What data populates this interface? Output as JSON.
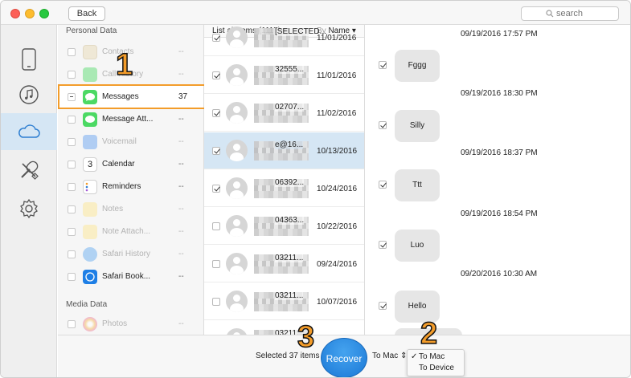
{
  "toolbar": {
    "back_label": "Back",
    "search_placeholder": "search"
  },
  "sidebar_rail": [
    {
      "name": "device-icon"
    },
    {
      "name": "itunes-icon"
    },
    {
      "name": "icloud-icon",
      "active": true
    },
    {
      "name": "tools-icon"
    },
    {
      "name": "settings-icon"
    }
  ],
  "categories": {
    "personal_title": "Personal Data",
    "items": [
      {
        "label": "Contacts",
        "count": "--",
        "dim": true,
        "icon": "contacts-icon",
        "color": "#e8d8b0"
      },
      {
        "label": "Call History",
        "count": "--",
        "dim": true,
        "icon": "phone-icon",
        "color": "#4cd964"
      },
      {
        "label": "Messages",
        "count": "37",
        "dim": false,
        "icon": "messages-icon",
        "color": "#4cd964"
      },
      {
        "label": "Message Att...",
        "count": "--",
        "dim": false,
        "icon": "message-attachments-icon",
        "color": "#4cd964"
      },
      {
        "label": "Voicemail",
        "count": "--",
        "dim": true,
        "icon": "voicemail-icon",
        "color": "#5b9bf0"
      },
      {
        "label": "Calendar",
        "count": "--",
        "dim": false,
        "icon": "calendar-icon",
        "color": "#ffffff",
        "text": "3"
      },
      {
        "label": "Reminders",
        "count": "--",
        "dim": false,
        "icon": "reminders-icon",
        "color": "#ffffff"
      },
      {
        "label": "Notes",
        "count": "--",
        "dim": true,
        "icon": "notes-icon",
        "color": "#fce48a"
      },
      {
        "label": "Note Attach...",
        "count": "--",
        "dim": true,
        "icon": "note-attachments-icon",
        "color": "#fce48a"
      },
      {
        "label": "Safari History",
        "count": "--",
        "dim": true,
        "icon": "safari-icon",
        "color": "#5aa7f0"
      },
      {
        "label": "Safari Book...",
        "count": "--",
        "dim": false,
        "icon": "safari-bookmarks-icon",
        "color": "#1e7fe6"
      }
    ],
    "media_title": "Media Data",
    "media_items": [
      {
        "label": "Photos",
        "count": "--",
        "dim": true,
        "icon": "photos-icon",
        "color": "#f7b84a"
      }
    ]
  },
  "list": {
    "header_left": "List all items (1117)",
    "header_right": "By Name",
    "rows": [
      {
        "contact": "[SELECTED...",
        "date": "11/01/2016",
        "checked": true,
        "selected": false
      },
      {
        "contact": "32555...",
        "date": "11/01/2016",
        "checked": true,
        "selected": false
      },
      {
        "contact": "02707...",
        "date": "11/02/2016",
        "checked": true,
        "selected": false
      },
      {
        "contact": "e@16...",
        "date": "10/13/2016",
        "checked": true,
        "selected": true
      },
      {
        "contact": "06392...",
        "date": "10/24/2016",
        "checked": true,
        "selected": false
      },
      {
        "contact": "04363...",
        "date": "10/22/2016",
        "checked": false,
        "selected": false
      },
      {
        "contact": "03211...",
        "date": "09/24/2016",
        "checked": false,
        "selected": false
      },
      {
        "contact": "03211...",
        "date": "10/07/2016",
        "checked": false,
        "selected": false
      },
      {
        "contact": "03211...",
        "date": "",
        "checked": false,
        "selected": false
      }
    ]
  },
  "conversation": [
    {
      "timestamp": "09/19/2016 17:57 PM",
      "text": "Fggg"
    },
    {
      "timestamp": "09/19/2016 18:30 PM",
      "text": "Silly"
    },
    {
      "timestamp": "09/19/2016 18:37 PM",
      "text": "Ttt"
    },
    {
      "timestamp": "09/19/2016 18:54 PM",
      "text": "Luo"
    },
    {
      "timestamp": "09/20/2016 10:30 AM",
      "text": "Hello"
    }
  ],
  "bottom": {
    "selected_text": "Selected 37 items",
    "recover_label": "Recover",
    "destination": "To Mac",
    "options": [
      "To Mac",
      "To Device"
    ],
    "checked_option_mark": "✓"
  },
  "steps": [
    "1",
    "2",
    "3"
  ],
  "colors": {
    "accent": "#f39c2a",
    "selection": "#d5e6f4",
    "recover": "#1a78d6"
  }
}
